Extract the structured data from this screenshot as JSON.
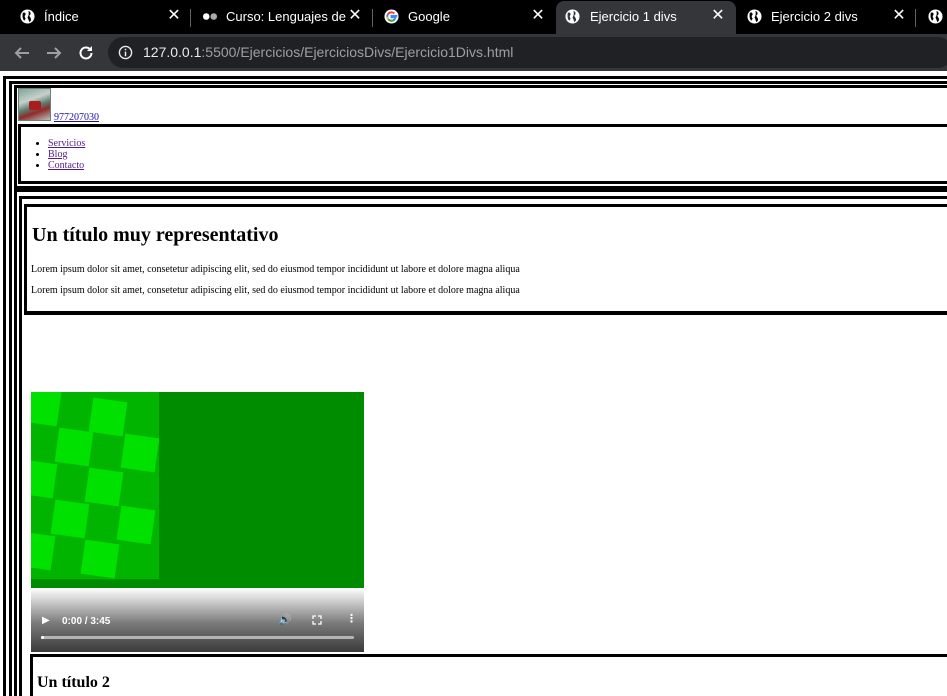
{
  "browser": {
    "tabs": [
      {
        "title": "Índice",
        "icon": "globe-icon",
        "active": false
      },
      {
        "title": "Curso: Lenguajes de M",
        "icon": "dots-icon",
        "active": false
      },
      {
        "title": "Google",
        "icon": "google-icon",
        "active": false
      },
      {
        "title": "Ejercicio 1 divs",
        "icon": "globe-icon",
        "active": true
      },
      {
        "title": "Ejercicio 2 divs",
        "icon": "globe-icon",
        "active": false
      }
    ],
    "url_host": "127.0.0.1",
    "url_rest": ":5500/Ejercicios/EjerciciosDivs/Ejercicio1Divs.html"
  },
  "page": {
    "header": {
      "phone": "977207030",
      "nav": [
        "Servicios",
        "Blog",
        "Contacto"
      ]
    },
    "section": {
      "title": "Un título muy representativo",
      "paragraphs": [
        "Lorem ipsum dolor sit amet, consetetur adipiscing elit, sed do eiusmod tempor incididunt ut labore et dolore magna aliqua",
        "Lorem ipsum dolor sit amet, consetetur adipiscing elit, sed do eiusmod tempor incididunt ut labore et dolore magna aliqua"
      ]
    },
    "video": {
      "time": "0:00 / 3:45",
      "progress": 0.0
    },
    "section2": {
      "title": "Un título 2"
    }
  }
}
